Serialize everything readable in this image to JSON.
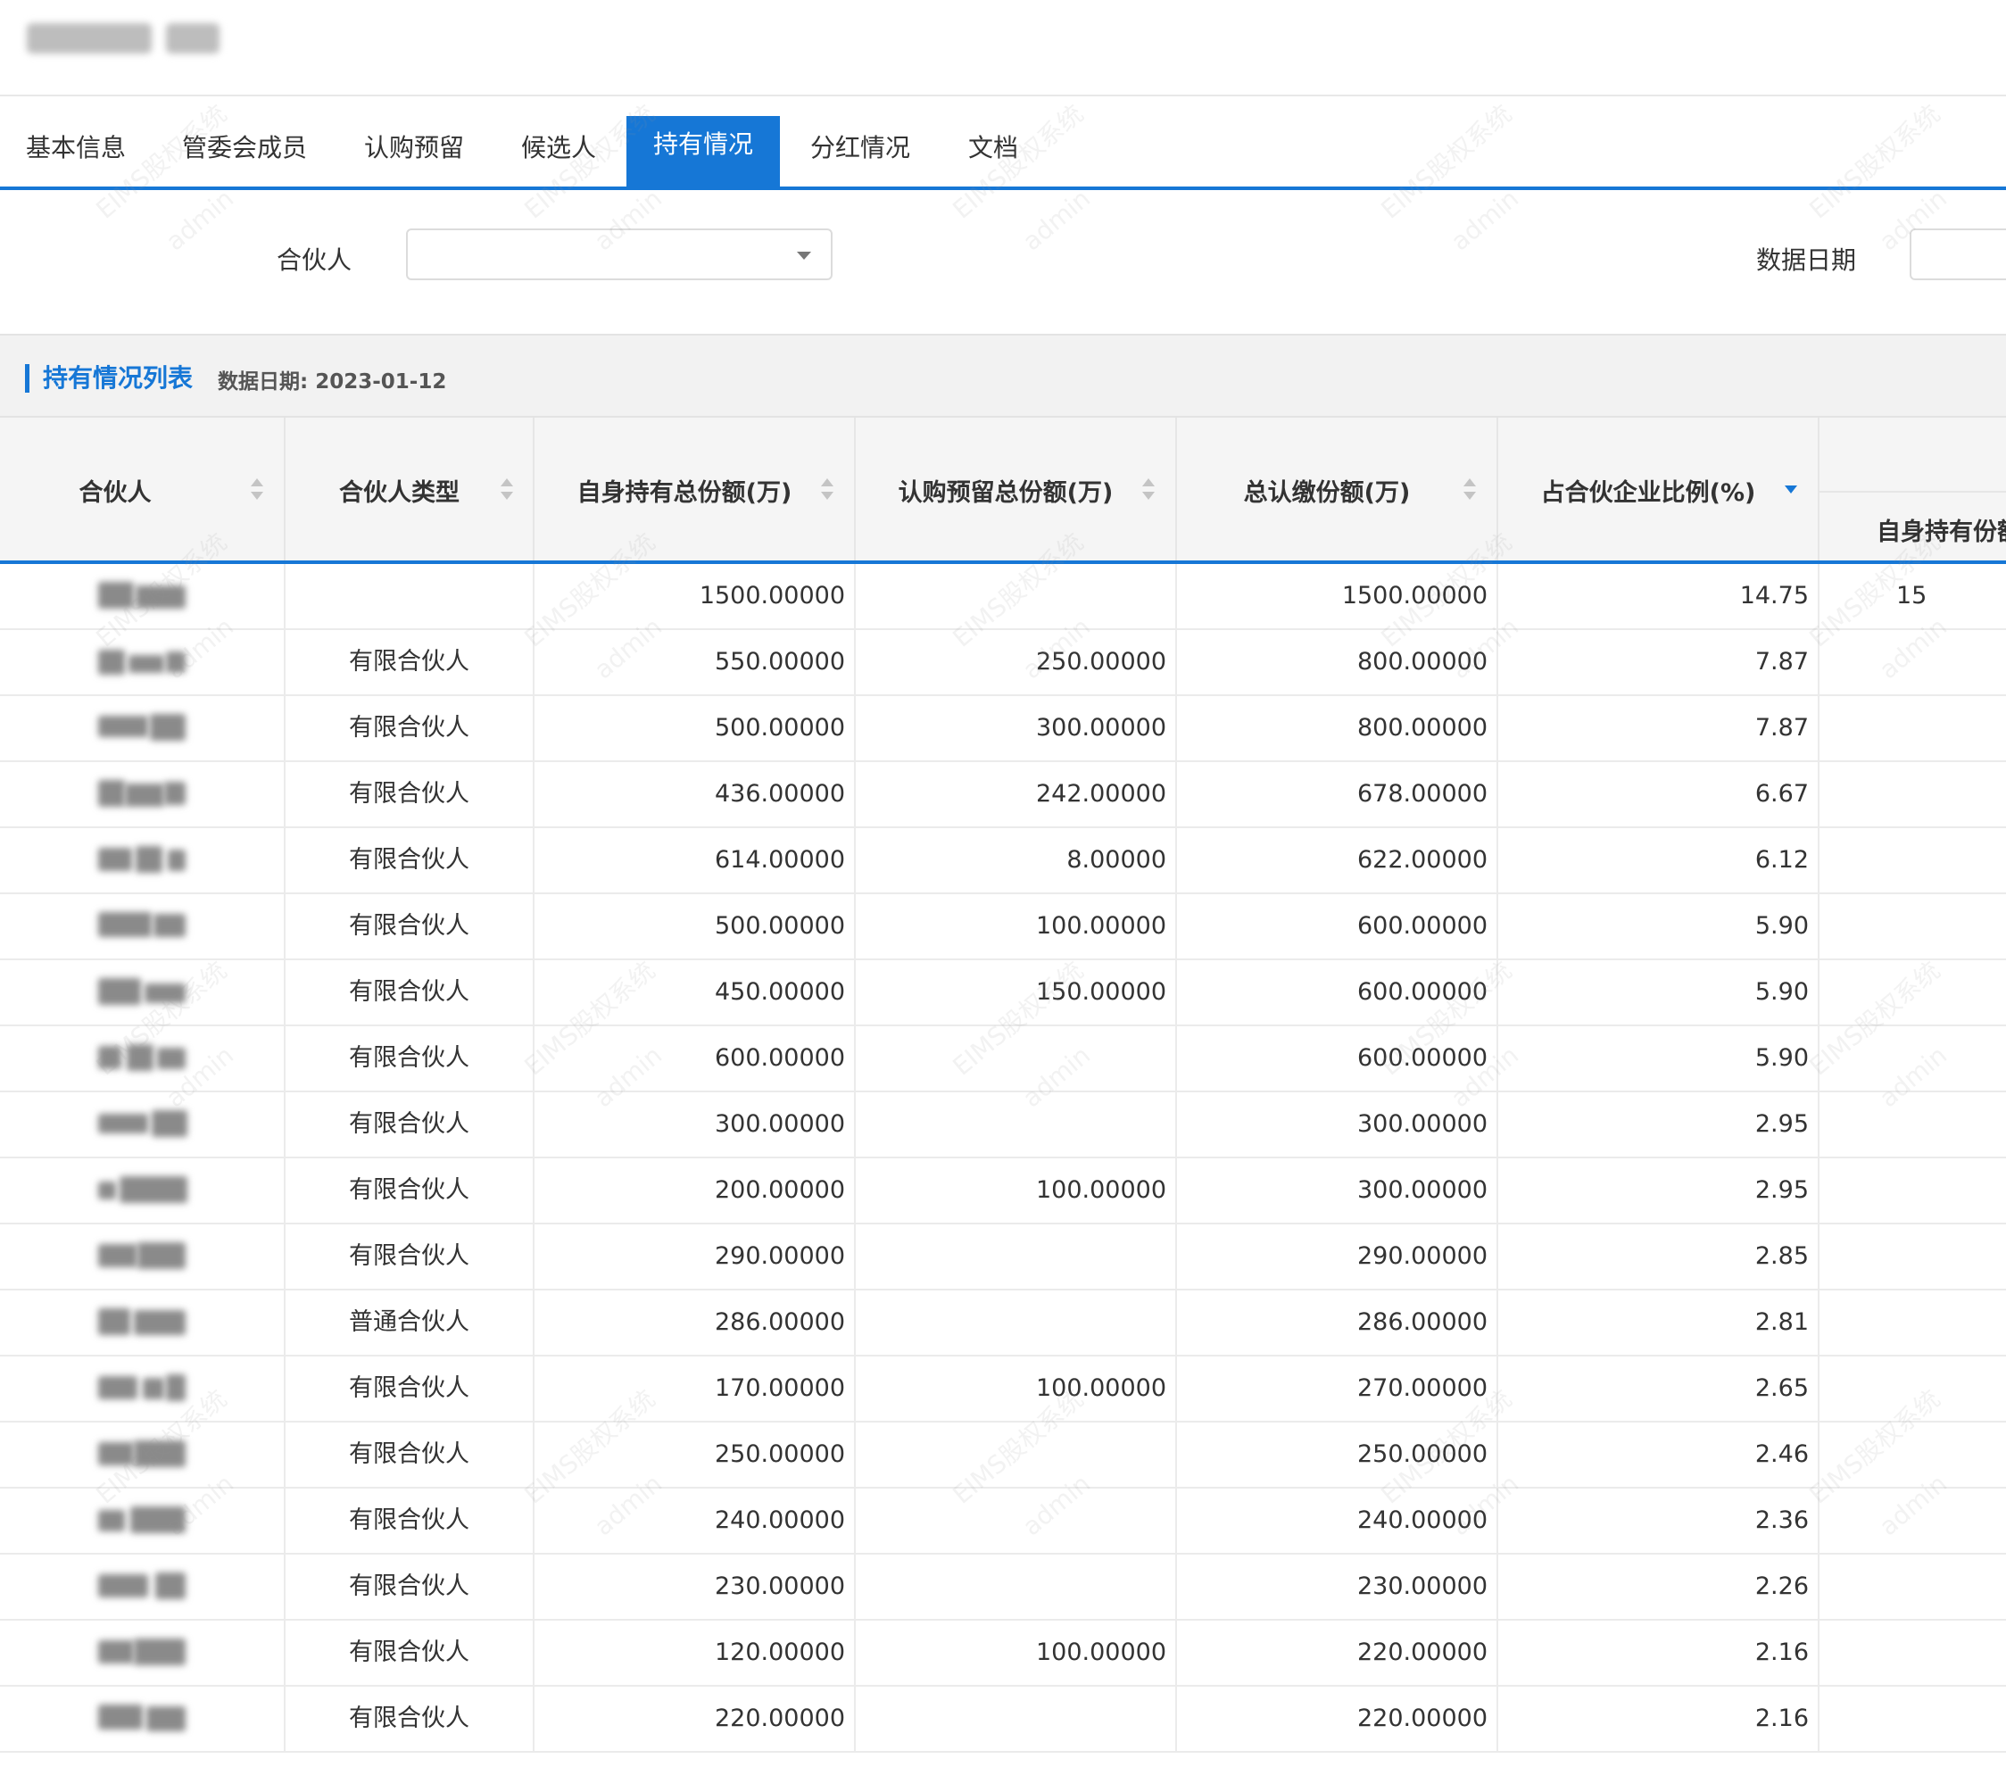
{
  "tabs": [
    "基本信息",
    "管委会成员",
    "认购预留",
    "候选人",
    "持有情况",
    "分红情况",
    "文档"
  ],
  "active_tab": "持有情况",
  "filters": {
    "partner_label": "合伙人",
    "partner_value": "",
    "date_label": "数据日期"
  },
  "section": {
    "title": "持有情况列表",
    "date": "数据日期: 2023-01-12"
  },
  "table": {
    "columns": [
      "合伙人",
      "合伙人类型",
      "自身持有总份额(万)",
      "认购预留总份额(万)",
      "总认缴份额(万)",
      "占合伙企业比例(%)"
    ],
    "group_sub_header": "自身持有份额",
    "sorted_column": "占合伙企业比例(%)",
    "sort_direction": "descending",
    "rows": [
      {
        "type": "",
        "self": "1500.00000",
        "reserve": "",
        "total": "1500.00000",
        "ratio": "14.75",
        "next": "15"
      },
      {
        "type": "有限合伙人",
        "self": "550.00000",
        "reserve": "250.00000",
        "total": "800.00000",
        "ratio": "7.87",
        "next": ""
      },
      {
        "type": "有限合伙人",
        "self": "500.00000",
        "reserve": "300.00000",
        "total": "800.00000",
        "ratio": "7.87",
        "next": ""
      },
      {
        "type": "有限合伙人",
        "self": "436.00000",
        "reserve": "242.00000",
        "total": "678.00000",
        "ratio": "6.67",
        "next": ""
      },
      {
        "type": "有限合伙人",
        "self": "614.00000",
        "reserve": "8.00000",
        "total": "622.00000",
        "ratio": "6.12",
        "next": ""
      },
      {
        "type": "有限合伙人",
        "self": "500.00000",
        "reserve": "100.00000",
        "total": "600.00000",
        "ratio": "5.90",
        "next": ""
      },
      {
        "type": "有限合伙人",
        "self": "450.00000",
        "reserve": "150.00000",
        "total": "600.00000",
        "ratio": "5.90",
        "next": ""
      },
      {
        "type": "有限合伙人",
        "self": "600.00000",
        "reserve": "",
        "total": "600.00000",
        "ratio": "5.90",
        "next": ""
      },
      {
        "type": "有限合伙人",
        "self": "300.00000",
        "reserve": "",
        "total": "300.00000",
        "ratio": "2.95",
        "next": ""
      },
      {
        "type": "有限合伙人",
        "self": "200.00000",
        "reserve": "100.00000",
        "total": "300.00000",
        "ratio": "2.95",
        "next": ""
      },
      {
        "type": "有限合伙人",
        "self": "290.00000",
        "reserve": "",
        "total": "290.00000",
        "ratio": "2.85",
        "next": ""
      },
      {
        "type": "普通合伙人",
        "self": "286.00000",
        "reserve": "",
        "total": "286.00000",
        "ratio": "2.81",
        "next": ""
      },
      {
        "type": "有限合伙人",
        "self": "170.00000",
        "reserve": "100.00000",
        "total": "270.00000",
        "ratio": "2.65",
        "next": ""
      },
      {
        "type": "有限合伙人",
        "self": "250.00000",
        "reserve": "",
        "total": "250.00000",
        "ratio": "2.46",
        "next": ""
      },
      {
        "type": "有限合伙人",
        "self": "240.00000",
        "reserve": "",
        "total": "240.00000",
        "ratio": "2.36",
        "next": ""
      },
      {
        "type": "有限合伙人",
        "self": "230.00000",
        "reserve": "",
        "total": "230.00000",
        "ratio": "2.26",
        "next": ""
      },
      {
        "type": "有限合伙人",
        "self": "120.00000",
        "reserve": "100.00000",
        "total": "220.00000",
        "ratio": "2.16",
        "next": ""
      },
      {
        "type": "有限合伙人",
        "self": "220.00000",
        "reserve": "",
        "total": "220.00000",
        "ratio": "2.16",
        "next": ""
      }
    ]
  },
  "watermark": {
    "text": "EIMS股权系统",
    "user": "admin"
  },
  "colors": {
    "accent": "#1677d6",
    "header_bg": "#f5f5f5",
    "section_bg": "#f2f2f2"
  },
  "icons": {
    "select_caret": "caret-down-icon",
    "sort": "sort-icon"
  }
}
